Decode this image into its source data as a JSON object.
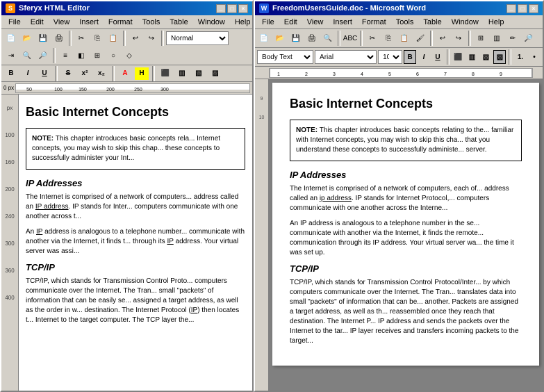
{
  "leftPanel": {
    "titleBar": "Sferyx HTML Editor",
    "menuItems": [
      "File",
      "Edit",
      "View",
      "Insert",
      "Format",
      "Tools",
      "Table",
      "Window",
      "Help"
    ],
    "styleDropdownValue": "Normal",
    "ruler": {
      "marks": [
        "0 px",
        "50",
        "100",
        "150",
        "200",
        "250",
        "300"
      ]
    },
    "document": {
      "title": "Basic Internet Concepts",
      "noteLabel": "NOTE:",
      "noteText": " This chapter introduces basic concepts rela... Internet concepts, you may wish to skip this chap... these concepts to successfully administer your Int...",
      "section1Title": "IP Addresses",
      "section1Para1": "The Internet is comprised of a network of computers... address called an IP address. IP stands for Inter... computers communicate with one another across t...",
      "section1Para2": "An IP address is analogous to a telephone number... communicate with another via the Internet, it finds t... through its IP address. Your virtual server was assi...",
      "section2Title": "TCP/IP",
      "section2Para": "TCP/IP, which stands for Transmission Control Proto... computers communicate over the Internet. The Tran... small \"packets\" of information that can be easily se... assigned a target address, as well as the order in w... destination. The Internet Protocol (IP) then locates t... Internet to the target computer. The TCP layer the..."
    }
  },
  "rightPanel": {
    "titleBar": "FreedomUsersGuide.doc - Microsoft Word",
    "menuItems": [
      "File",
      "Edit",
      "View",
      "Insert",
      "Format",
      "Tools",
      "Table",
      "Window",
      "Help"
    ],
    "formatBar": {
      "styleValue": "Body Text",
      "fontValue": "Arial",
      "sizeValue": "10",
      "boldActive": true
    },
    "document": {
      "title": "Basic Internet Concepts",
      "noteLabel": "NOTE:",
      "noteText": " This chapter introduces basic concepts relating to the... familiar with Internet concepts, you may wish to skip this cha... that you understand these concepts to successfully administe... server.",
      "section1Title": "IP Addresses",
      "section1Para1": "The Internet is comprised of a network of computers, each of... address called an ip address. IP stands for Internet Protocol,... computers communicate with one another across the Interne...",
      "section1Para2": "An IP address is analogous to a telephone number in the se... communicate with another via the Internet, it finds the remote... communication through its IP address. Your virtual server wa... the time it was set up.",
      "section2Title": "TCP/IP",
      "section2Para1": "TCP/IP, which stands for Transmission Control Protocol/Inter... by which computers communicate over the Internet. The Trar... translates data into small \"packets\" of information that can be... another. Packets are assigned a target address, as well as th... reassembled once they reach that destination. The Internet P... IP address and sends the packets over the Internet to the tar... IP layer receives and transfers incoming packets to the target..."
    }
  }
}
